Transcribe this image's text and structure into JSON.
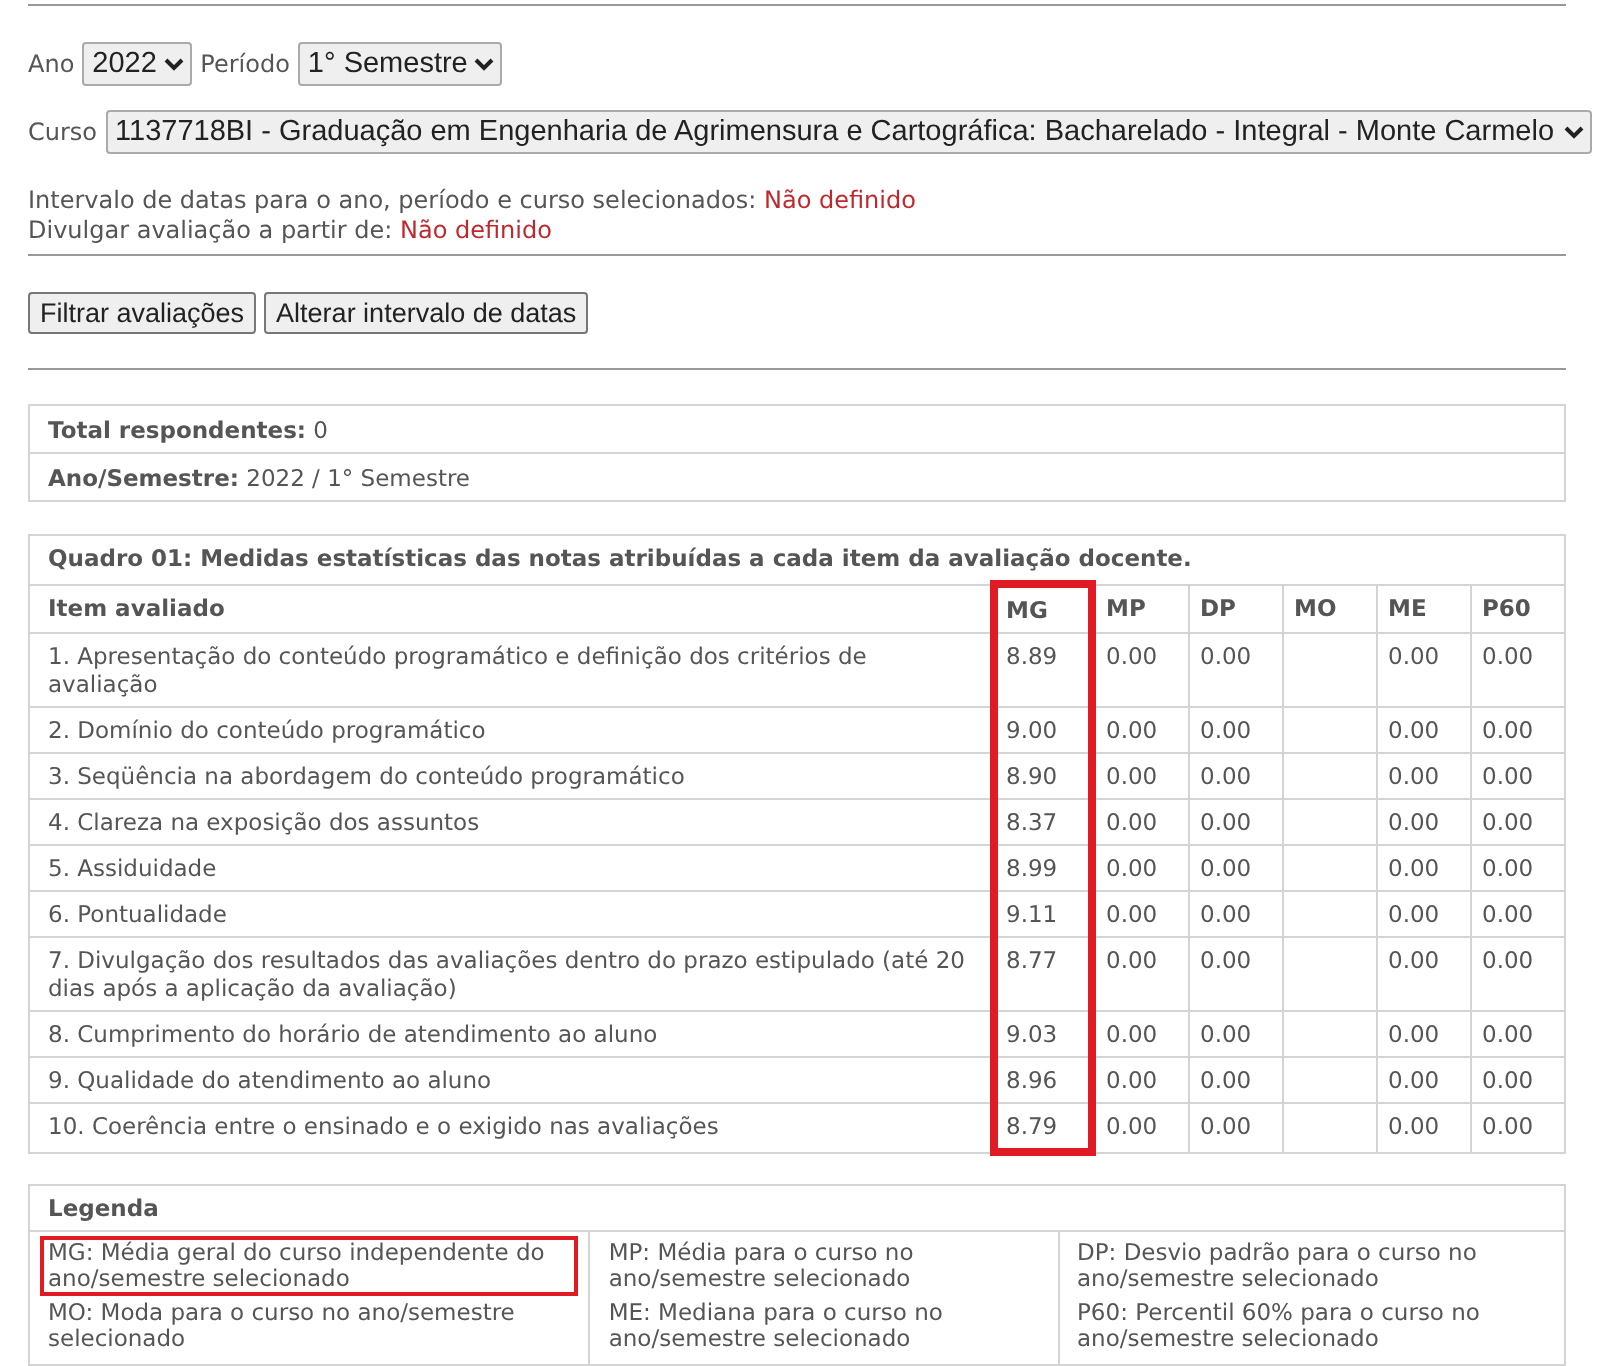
{
  "filters": {
    "year": {
      "label": "Ano",
      "value": "2022"
    },
    "period": {
      "label": "Período",
      "value": "1° Semestre"
    },
    "course": {
      "label": "Curso",
      "value": "1137718BI - Graduação em Engenharia de Agrimensura e Cartográfica: Bacharelado - Integral - Monte Carmelo"
    }
  },
  "info": [
    {
      "label": "Intervalo de datas para o ano, período e curso selecionados:",
      "value": "Não definido"
    },
    {
      "label": "Divulgar avaliação a partir de:",
      "value": "Não definido"
    }
  ],
  "buttons": [
    "Filtrar avaliações",
    "Alterar intervalo de datas"
  ],
  "summary": [
    "**Total respondentes:** 0",
    "**Ano/Semestre:** 2022 / 1° Semestre"
  ],
  "table": {
    "title": "Quadro 01: Medidas estatísticas das notas atribuídas a cada item da avaliação docente.",
    "columns": [
      {
        "label": "Item avaliado",
        "highlighted": false
      },
      {
        "label": "MG",
        "highlighted": true
      },
      {
        "label": "MP",
        "highlighted": false
      },
      {
        "label": "DP",
        "highlighted": false
      },
      {
        "label": "MO",
        "highlighted": false
      },
      {
        "label": "ME",
        "highlighted": false
      },
      {
        "label": "P60",
        "highlighted": false
      }
    ],
    "rows": [
      [
        "1. Apresentação do conteúdo programático e definição dos critérios de avaliação",
        "8.89",
        "0.00",
        "0.00",
        null,
        "0.00",
        "0.00"
      ],
      [
        "2. Domínio do conteúdo programático",
        "9.00",
        "0.00",
        "0.00",
        null,
        "0.00",
        "0.00"
      ],
      [
        "3. Seqüência na abordagem do conteúdo programático",
        "8.90",
        "0.00",
        "0.00",
        null,
        "0.00",
        "0.00"
      ],
      [
        "4. Clareza na exposição dos assuntos",
        "8.37",
        "0.00",
        "0.00",
        null,
        "0.00",
        "0.00"
      ],
      [
        "5. Assiduidade",
        "8.99",
        "0.00",
        "0.00",
        null,
        "0.00",
        "0.00"
      ],
      [
        "6. Pontualidade",
        "9.11",
        "0.00",
        "0.00",
        null,
        "0.00",
        "0.00"
      ],
      [
        "7. Divulgação dos resultados das avaliações dentro do prazo estipulado (até 20 dias após a aplicação da avaliação)",
        "8.77",
        "0.00",
        "0.00",
        null,
        "0.00",
        "0.00"
      ],
      [
        "8. Cumprimento do horário de atendimento ao aluno",
        "9.03",
        "0.00",
        "0.00",
        null,
        "0.00",
        "0.00"
      ],
      [
        "9. Qualidade do atendimento ao aluno",
        "8.96",
        "0.00",
        "0.00",
        null,
        "0.00",
        "0.00"
      ],
      [
        "10. Coerência entre o ensinado e o exigido nas avaliações",
        "8.79",
        "0.00",
        "0.00",
        null,
        "0.00",
        "0.00"
      ]
    ]
  },
  "legend": {
    "title": "Legenda",
    "columns": [
      [
        {
          "text": "MG: Média geral do curso independente do ano/semestre selecionado",
          "highlighted": true
        },
        {
          "text": "MO: Moda para o curso no ano/semestre selecionado",
          "highlighted": false
        }
      ],
      [
        {
          "text": "MP: Média para o curso no ano/semestre selecionado",
          "highlighted": false
        },
        {
          "text": "ME: Mediana para o curso no ano/semestre selecionado",
          "highlighted": false
        }
      ],
      [
        {
          "text": "DP: Desvio padrão para o curso no ano/semestre selecionado",
          "highlighted": false
        },
        {
          "text": "P60: Percentil 60% para o curso no ano/semestre selecionado",
          "highlighted": false
        }
      ]
    ]
  }
}
